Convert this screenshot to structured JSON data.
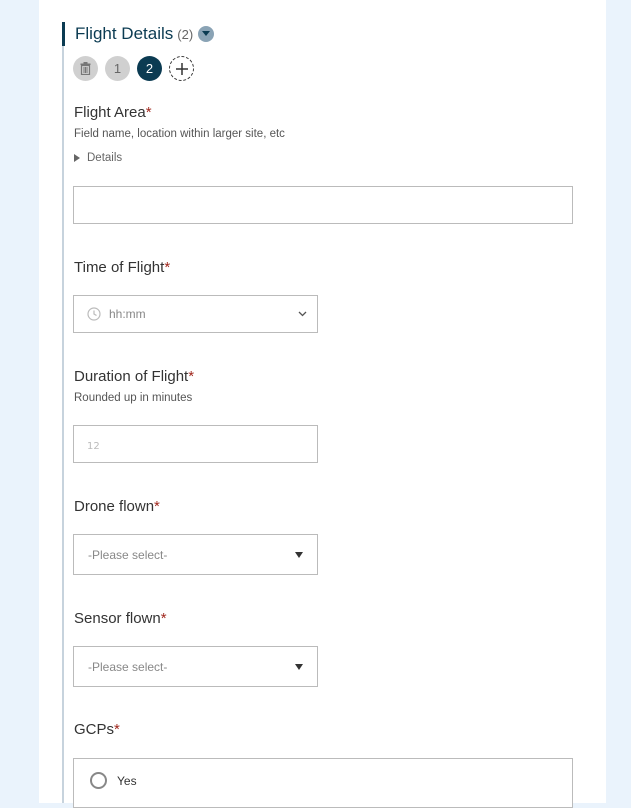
{
  "section": {
    "title": "Flight Details",
    "count": "(2)",
    "tabs": [
      "1",
      "2"
    ]
  },
  "fields": {
    "flight_area": {
      "label": "Flight Area",
      "required": "*",
      "hint": "Field name, location within larger site, etc",
      "details_label": "Details",
      "value": ""
    },
    "time_of_flight": {
      "label": "Time of Flight",
      "required": "*",
      "placeholder": "hh:mm"
    },
    "duration_of_flight": {
      "label": "Duration of Flight",
      "required": "*",
      "hint": "Rounded up in minutes",
      "value": ""
    },
    "drone_flown": {
      "label": "Drone flown",
      "required": "*",
      "selected": "-Please select-"
    },
    "sensor_flown": {
      "label": "Sensor flown",
      "required": "*",
      "selected": "-Please select-"
    },
    "gcps": {
      "label": "GCPs",
      "required": "*",
      "options": [
        "Yes"
      ]
    }
  },
  "colors": {
    "background": "#eaf3fc",
    "accent": "#0b3b52",
    "required": "#a0281e"
  }
}
